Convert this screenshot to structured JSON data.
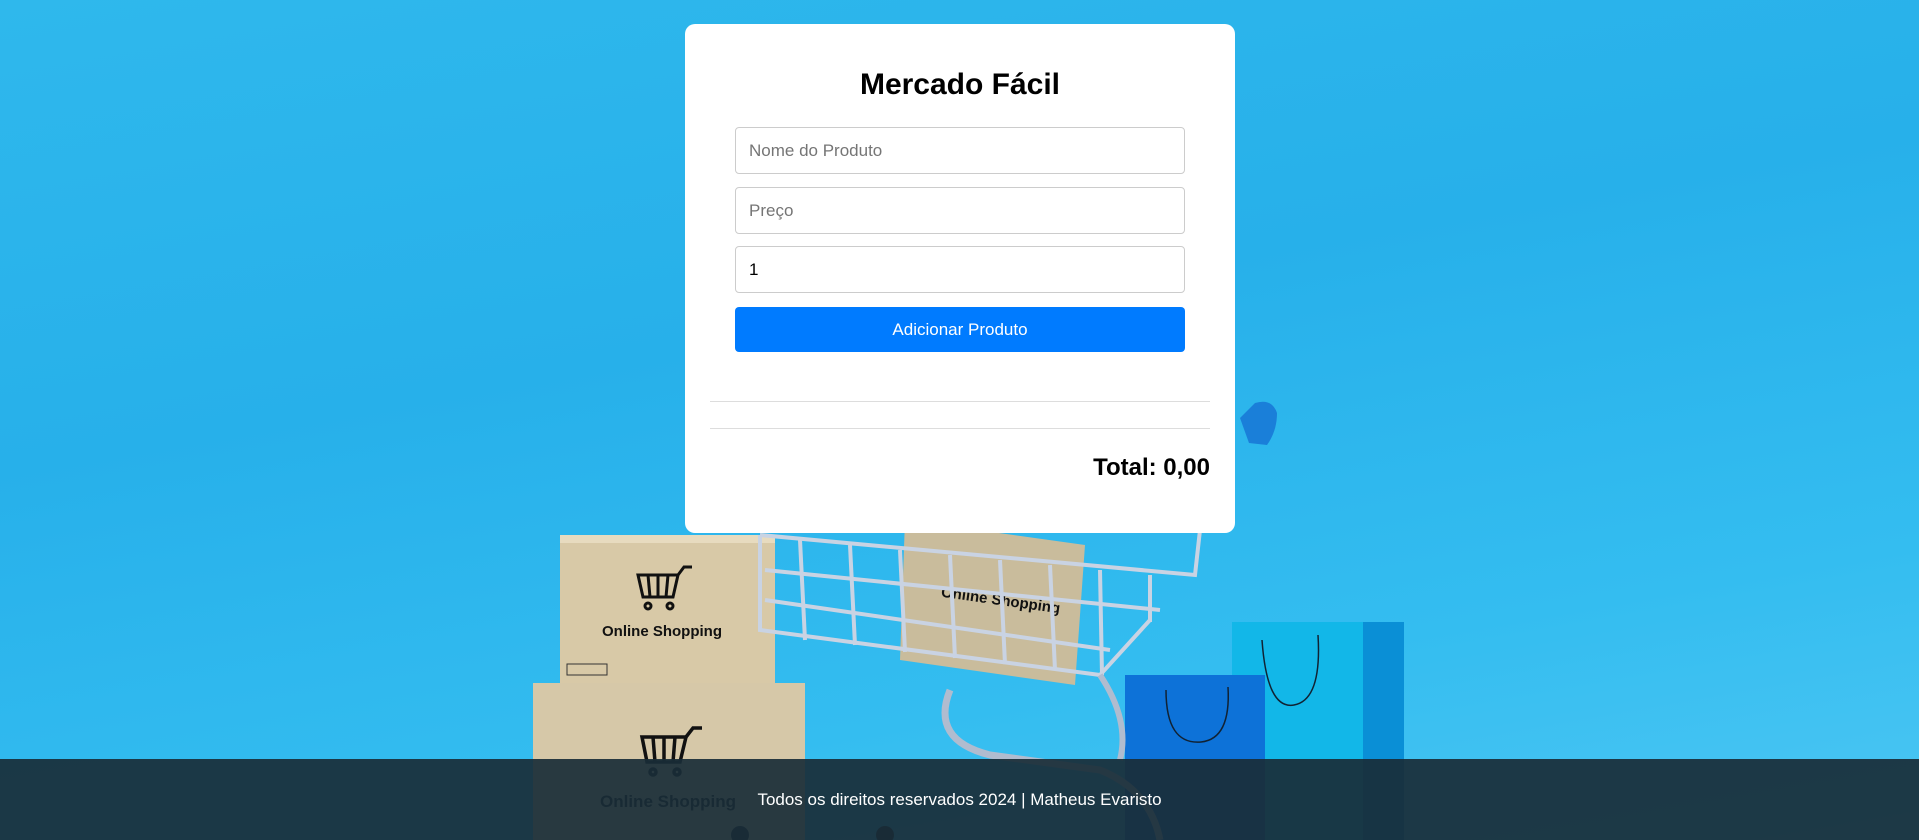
{
  "app": {
    "title": "Mercado Fácil"
  },
  "form": {
    "name_placeholder": "Nome do Produto",
    "price_placeholder": "Preço",
    "quantity_value": "1",
    "add_button_label": "Adicionar Produto"
  },
  "summary": {
    "total_label": "Total: 0,00"
  },
  "background": {
    "box_label": "Online Shopping"
  },
  "footer": {
    "text": "Todos os direitos reservados 2024 | Matheus Evaristo"
  },
  "colors": {
    "accent": "#007bff",
    "background": "#29b3eb",
    "footer": "#192d37"
  },
  "icons": [
    "shopping-cart-icon"
  ]
}
